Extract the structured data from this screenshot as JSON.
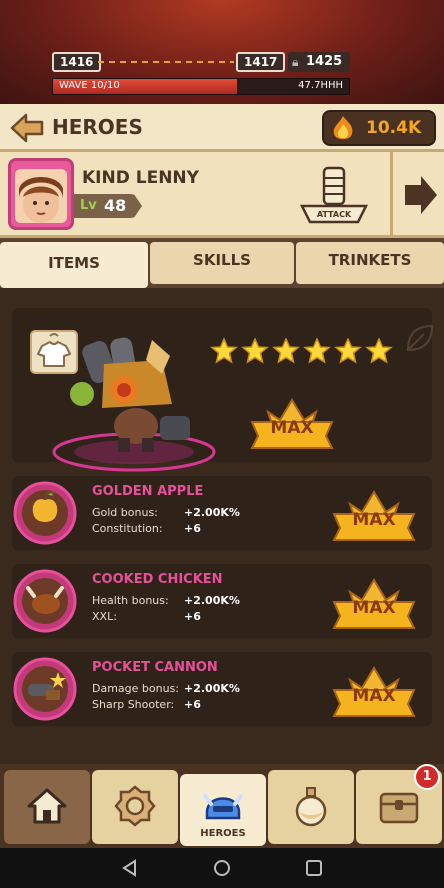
{
  "wave": {
    "current_level": "1416",
    "next_level": "1417",
    "locked_level": "1425",
    "wave_label": "WAVE 10/10",
    "wave_progress": 0.62,
    "wave_value": "47.7HHH"
  },
  "header": {
    "title": "HEROES",
    "gems": "10.4K"
  },
  "hero": {
    "name": "KIND LENNY",
    "level_label": "Lv",
    "level": "48",
    "role": "ATTACK",
    "stars": 6
  },
  "tabs": [
    {
      "label": "ITEMS",
      "active": true
    },
    {
      "label": "SKILLS",
      "active": false
    },
    {
      "label": "TRINKETS",
      "active": false
    }
  ],
  "max_label": "MAX",
  "items": [
    {
      "name": "GOLDEN APPLE",
      "stat1_key": "Gold bonus:",
      "stat1_val": "+2.00K%",
      "stat2_key": "Constitution:",
      "stat2_val": "+6",
      "max": "MAX"
    },
    {
      "name": "COOKED CHICKEN",
      "stat1_key": "Health bonus:",
      "stat1_val": "+2.00K%",
      "stat2_key": "XXL:",
      "stat2_val": "+6",
      "max": "MAX"
    },
    {
      "name": "POCKET CANNON",
      "stat1_key": "Damage bonus:",
      "stat1_val": "+2.00K%",
      "stat2_key": "Sharp Shooter:",
      "stat2_val": "+6",
      "max": "MAX"
    }
  ],
  "nav": {
    "home_icon": "home-icon",
    "gear_icon": "gear-icon",
    "heroes_label": "HEROES",
    "potion_icon": "potion-icon",
    "chest_icon": "chest-icon",
    "notification_count": "1"
  },
  "colors": {
    "accent_pink": "#e8509a",
    "gold": "#f5a623",
    "header_bg": "#f3e6c7"
  }
}
